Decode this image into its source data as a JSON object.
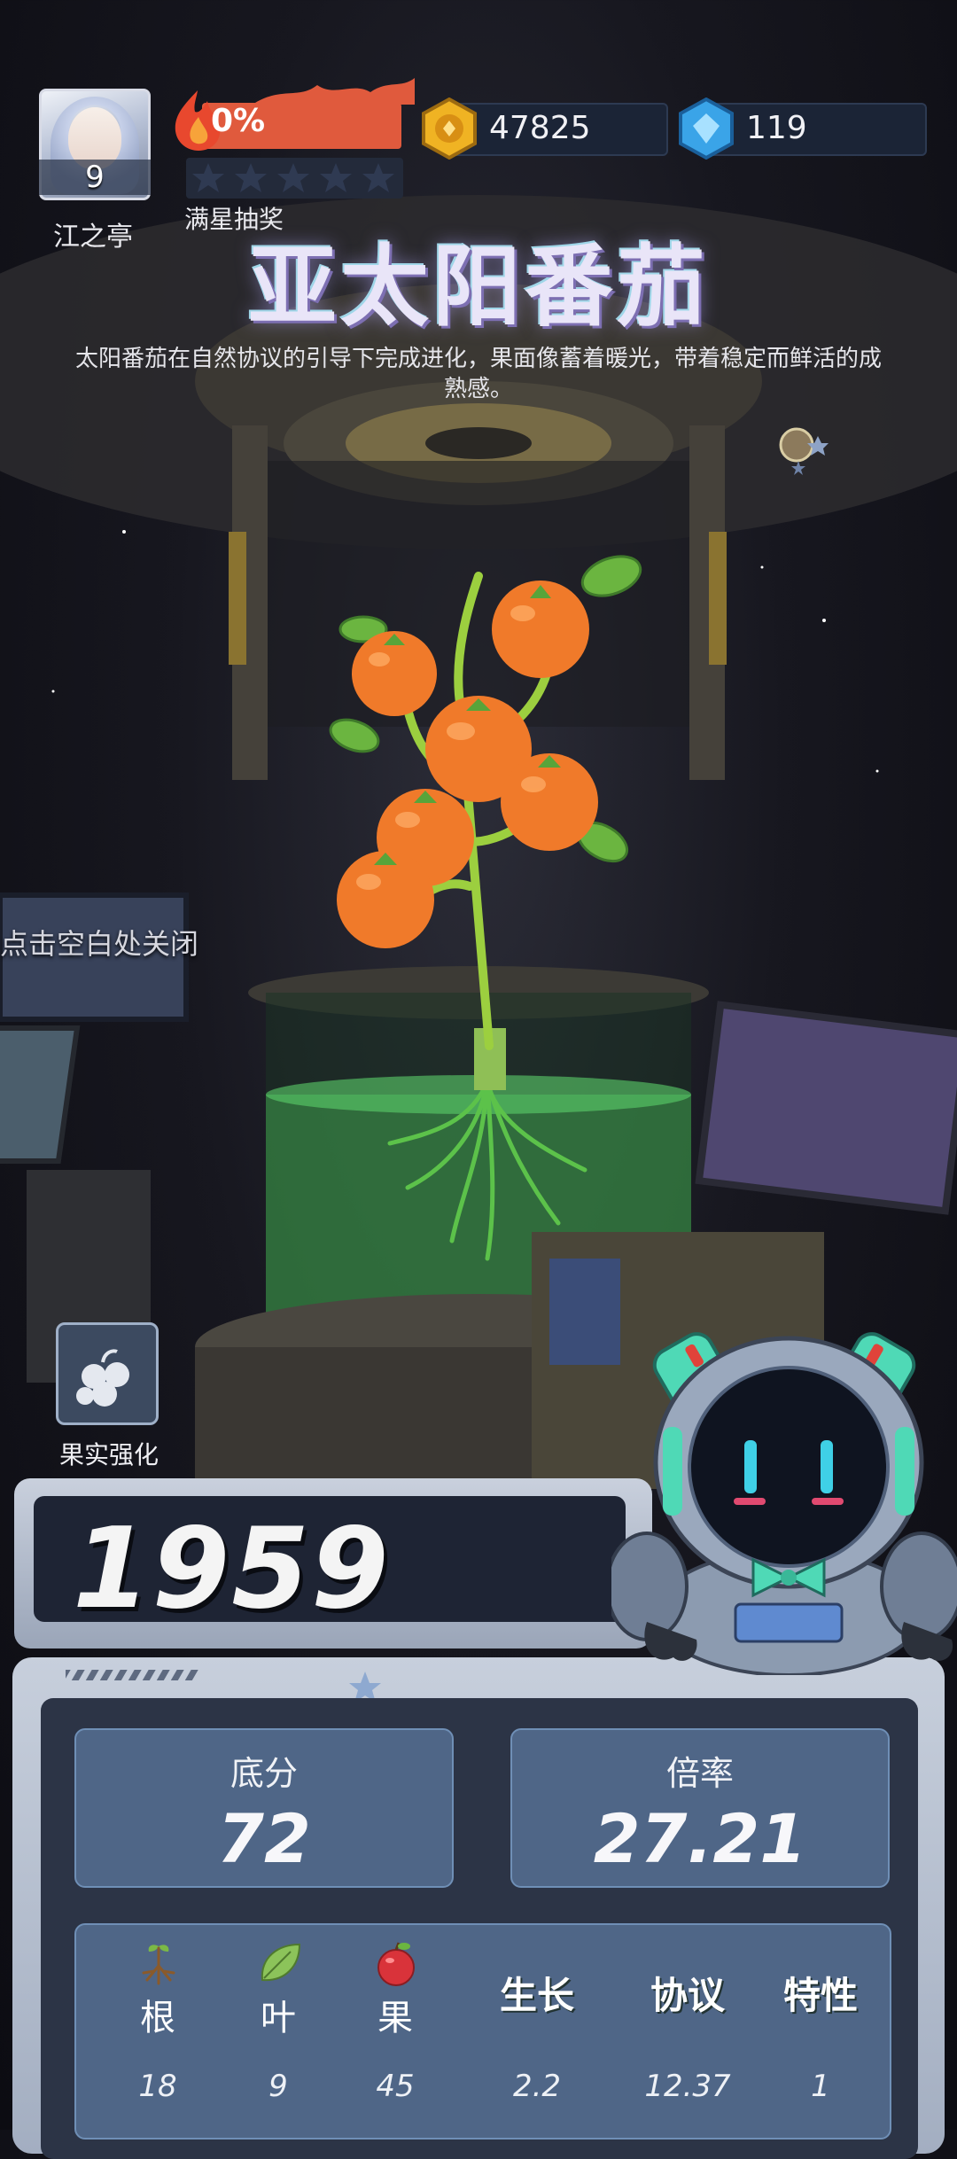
{
  "player": {
    "level": "9",
    "name": "江之亭"
  },
  "flame": {
    "percent": "0%",
    "progress": 0
  },
  "stars": {
    "filled": 0,
    "total": 5
  },
  "lottery_label": "满星抽奖",
  "currency": {
    "coins": "47825",
    "gems": "119"
  },
  "plant": {
    "title": "亚太阳番茄",
    "description": "太阳番茄在自然协议的引导下完成进化，果面像蓄着暖光，带着稳定而鲜活的成熟感。"
  },
  "close_hint": "点击空白处关闭",
  "fruit_enhance_label": "果实强化",
  "score": "1959",
  "stats": {
    "base_label": "底分",
    "base_value": "72",
    "multiplier_label": "倍率",
    "multiplier_value": "27.21"
  },
  "attributes": [
    {
      "label": "根",
      "value": "18",
      "icon": "root-icon"
    },
    {
      "label": "叶",
      "value": "9",
      "icon": "leaf-icon"
    },
    {
      "label": "果",
      "value": "45",
      "icon": "apple-icon"
    },
    {
      "label": "生长",
      "value": "2.2"
    },
    {
      "label": "协议",
      "value": "12.37"
    },
    {
      "label": "特性",
      "value": "1"
    }
  ],
  "colors": {
    "flame": "#e05a3d",
    "coin": "#f0b323",
    "gem": "#3aa4e8",
    "panel": "#4f6687",
    "tomato": "#f07a2a"
  }
}
